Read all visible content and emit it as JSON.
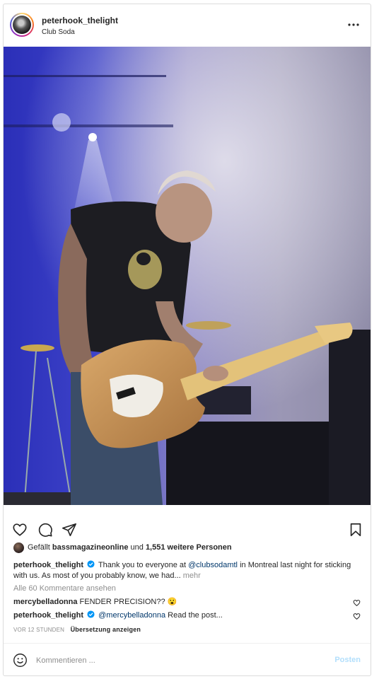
{
  "post": {
    "username": "peterhook_thelight",
    "location": "Club Soda"
  },
  "icons": {
    "more": "more-horizontal-icon",
    "like": "heart-icon",
    "comment": "comment-icon",
    "share": "paper-plane-icon",
    "save": "bookmark-icon",
    "verified": "verified-badge-icon",
    "emoji": "emoji-icon"
  },
  "likes": {
    "prefix": "Gefällt",
    "user": "bassmagazineonline",
    "conjunction": "und",
    "others": "1,551 weitere Personen"
  },
  "caption": {
    "username": "peterhook_thelight",
    "text_before_mention": "Thank you to everyone at",
    "mention": "@clubsodamtl",
    "text_after_mention": "in Montreal last night for sticking with us. As most of you probably know, we had...",
    "more": "mehr"
  },
  "view_all_comments": "Alle 60 Kommentare ansehen",
  "comments": [
    {
      "username": "mercybelladonna",
      "text": "FENDER PRECISION?? 😮",
      "verified": false
    },
    {
      "username": "peterhook_thelight",
      "mention": "@mercybelladonna",
      "text": "Read the post...",
      "verified": true
    }
  ],
  "timestamp": "VOR 12 STUNDEN",
  "translate_label": "Übersetzung anzeigen",
  "comment_box": {
    "placeholder": "Kommentieren ...",
    "post_label": "Posten"
  },
  "colors": {
    "link": "#00376b",
    "verified": "#0095f6",
    "muted": "#8e8e8e",
    "post_button_disabled": "#b2dffc"
  }
}
